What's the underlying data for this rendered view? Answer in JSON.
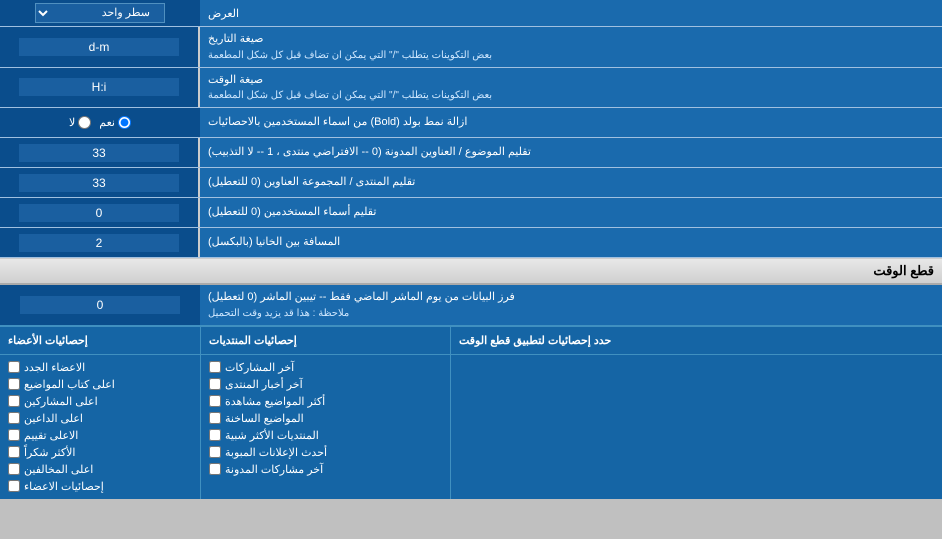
{
  "rows": [
    {
      "id": "display-row",
      "label": "العرض",
      "inputType": "dropdown",
      "value": "سطر واحد"
    },
    {
      "id": "date-format-row",
      "label": "صيغة التاريخ",
      "sublabel": "بعض التكوينات يتطلب \"/\" التي يمكن ان تضاف قبل كل شكل المطعمة",
      "inputType": "text",
      "value": "d-m"
    },
    {
      "id": "time-format-row",
      "label": "صيغة الوقت",
      "sublabel": "بعض التكوينات يتطلب \"/\" التي يمكن ان تضاف قبل كل شكل المطعمة",
      "inputType": "text",
      "value": "H:i"
    },
    {
      "id": "bold-remove-row",
      "label": "ازالة نمط بولد (Bold) من اسماء المستخدمين بالاحصائيات",
      "inputType": "radio",
      "options": [
        "نعم",
        "لا"
      ],
      "selected": "نعم"
    },
    {
      "id": "topics-count-row",
      "label": "تقليم الموضوع / العناوين المدونة (0 -- الافتراضي منتدى ، 1 -- لا التذبيب)",
      "inputType": "text",
      "value": "33"
    },
    {
      "id": "forum-group-row",
      "label": "تقليم المنتدى / المجموعة العناوين (0 للتعطيل)",
      "inputType": "text",
      "value": "33"
    },
    {
      "id": "usernames-row",
      "label": "تقليم أسماء المستخدمين (0 للتعطيل)",
      "inputType": "text",
      "value": "0"
    },
    {
      "id": "spacing-row",
      "label": "المسافة بين الخانيا (بالبكسل)",
      "inputType": "text",
      "value": "2"
    }
  ],
  "cutoff_section": {
    "title": "قطع الوقت",
    "row": {
      "label": "فرز البيانات من يوم الماشر الماضي فقط -- تيبين الماشر (0 لتعطيل)",
      "note": "ملاحظة : هذا قد يزيد وقت التحميل",
      "value": "0"
    },
    "limit_label": "حدد إحصائيات لتطبيق قطع الوقت"
  },
  "checkboxes": {
    "col1_header": "إحصائيات الأعضاء",
    "col2_header": "إحصائيات المنتديات",
    "col3_header": "",
    "col1_items": [
      {
        "label": "الاعضاء الجدد",
        "checked": false
      },
      {
        "label": "اعلى كتاب المواضيع",
        "checked": false
      },
      {
        "label": "اعلى المشاركين",
        "checked": false
      },
      {
        "label": "اعلى الداعين",
        "checked": false
      },
      {
        "label": "الاعلى تقييم",
        "checked": false
      },
      {
        "label": "الأكثر شكراً",
        "checked": false
      },
      {
        "label": "اعلى المخالفين",
        "checked": false
      },
      {
        "label": "إحصائيات الاعضاء",
        "checked": false
      }
    ],
    "col2_items": [
      {
        "label": "آخر المشاركات",
        "checked": false
      },
      {
        "label": "آخر أخبار المنتدى",
        "checked": false
      },
      {
        "label": "أكثر المواضيع مشاهدة",
        "checked": false
      },
      {
        "label": "المواضيع الساخنة",
        "checked": false
      },
      {
        "label": "المنتديات الأكثر شبية",
        "checked": false
      },
      {
        "label": "أحدث الإعلانات المبوبة",
        "checked": false
      },
      {
        "label": "آخر مشاركات المدونة",
        "checked": false
      }
    ]
  },
  "labels": {
    "display": "العرض",
    "single_line": "سطر واحد",
    "date_format": "صيغة التاريخ",
    "date_format_note": "بعض التكوينات يتطلب \"/\" التي يمكن ان تضاف قبل كل شكل المطعمة",
    "time_format": "صيغة الوقت",
    "time_format_note": "بعض التكوينات يتطلب \"/\" التي يمكن ان تضاف قبل كل شكل المطعمة",
    "bold_remove": "ازالة نمط بولد (Bold) من اسماء المستخدمين بالاحصائيات",
    "yes": "نعم",
    "no": "لا",
    "topics_trim": "تقليم الموضوع / العناوين المدونة (0 -- الافتراضي منتدى ، 1 -- لا التذبيب)",
    "forum_trim": "تقليم المنتدى / المجموعة العناوين (0 للتعطيل)",
    "users_trim": "تقليم أسماء المستخدمين (0 للتعطيل)",
    "spacing": "المسافة بين الخانيا (بالبكسل)",
    "cutoff_title": "قطع الوقت",
    "cutoff_label": "فرز البيانات من يوم الماشر الماضي فقط -- تيبين الماشر (0 لتعطيل)",
    "cutoff_note": "ملاحظة : هذا قد يزيد وقت التحميل",
    "cutoff_limit": "حدد إحصائيات لتطبيق قطع الوقت",
    "stats_members": "إحصائيات الأعضاء",
    "stats_forums": "إحصائيات المنتديات"
  }
}
